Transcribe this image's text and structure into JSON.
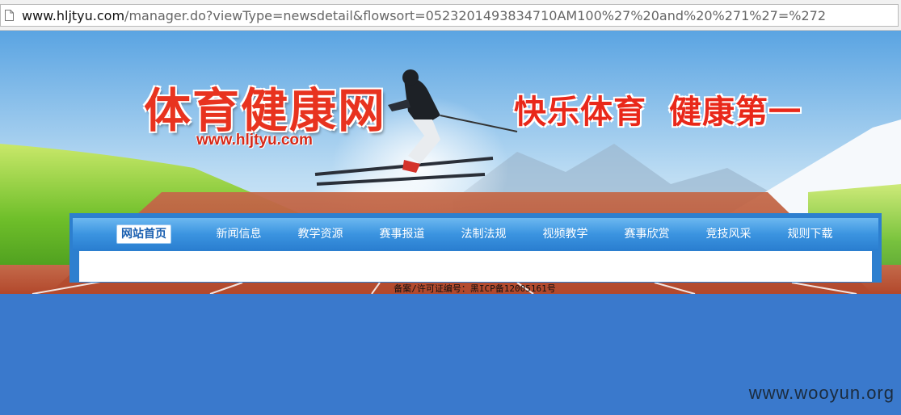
{
  "browser": {
    "url_host": "www.hljtyu.com",
    "url_rest": "/manager.do?viewType=newsdetail&flowsort=0523201493834710AM100%27%20and%20%271%27=%272"
  },
  "banner": {
    "site_title": "体育健康网",
    "site_domain": "www.hljtyu.com",
    "slogan_part1": "快乐体育",
    "slogan_part2": "健康第一"
  },
  "nav": {
    "items": [
      {
        "label": "网站首页",
        "active": true
      },
      {
        "label": "新闻信息"
      },
      {
        "label": "教学资源"
      },
      {
        "label": "赛事报道"
      },
      {
        "label": "法制法规"
      },
      {
        "label": "视频教学"
      },
      {
        "label": "赛事欣赏"
      },
      {
        "label": "竞技风采"
      },
      {
        "label": "规则下载"
      }
    ]
  },
  "footer": {
    "icp": "备案/许可证编号：黑ICP备12005161号"
  },
  "watermark": "www.wooyun.org",
  "colors": {
    "nav_blue": "#3b94e0",
    "title_red": "#e8331f",
    "page_bg": "#3a79cc"
  }
}
